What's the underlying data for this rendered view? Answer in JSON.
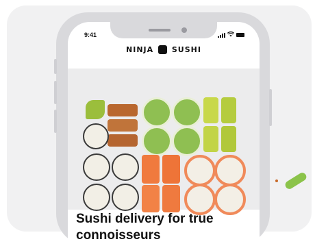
{
  "status_bar": {
    "time": "9:41"
  },
  "brand": {
    "logo_text_left": "NINJA",
    "logo_text_right": "SUSHI",
    "logo_icon": "sushi-roll-icon"
  },
  "hero": {
    "headline": "Sushi delivery for true connoisseurs"
  },
  "icons": {
    "signal": "signal-icon",
    "wifi": "wifi-icon",
    "battery": "battery-icon"
  },
  "colors": {
    "background": "#f1f1f2",
    "phone_frame": "#d9d9dc",
    "text": "#111111"
  }
}
